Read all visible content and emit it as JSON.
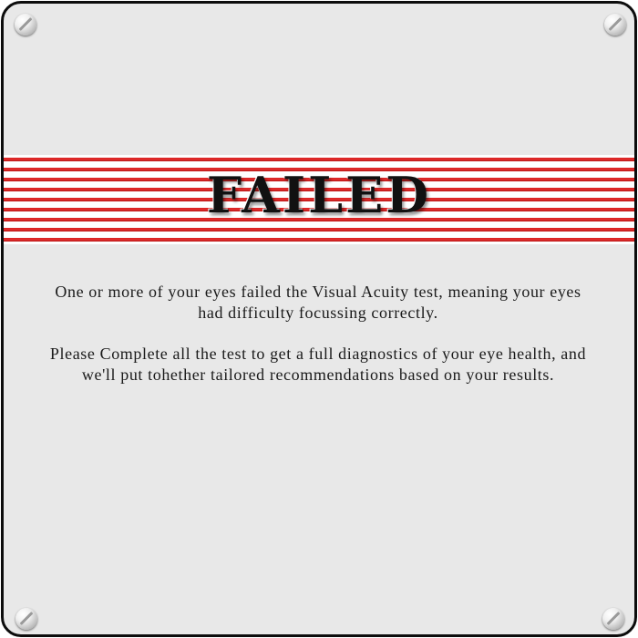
{
  "banner": {
    "title": "FAILED",
    "stripe_color": "#d62020"
  },
  "messages": [
    "One or more of your eyes failed the Visual Acuity test, meaning your eyes had difficulty focussing correctly.",
    "Please Complete all the test to get a full diagnostics of your eye health, and we'll put tohether tailored recommendations based on your results."
  ],
  "panel": {
    "background": "#e8e8e8",
    "border_color": "#0c0c0c"
  },
  "icons": {
    "corner_screws": [
      "screw-icon",
      "screw-icon",
      "screw-icon",
      "screw-icon"
    ]
  }
}
